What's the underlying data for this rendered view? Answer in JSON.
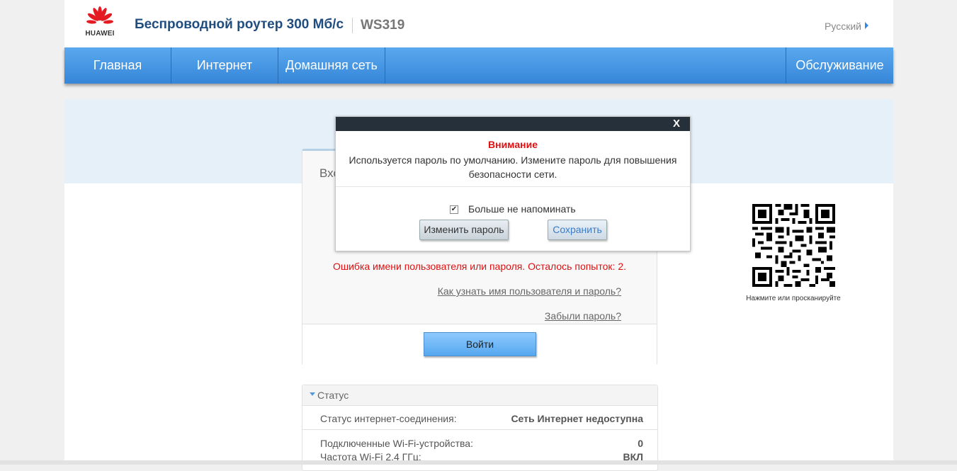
{
  "header": {
    "brand": "HUAWEI",
    "product_title": "Беспроводной роутер 300 Мб/с",
    "model": "WS319",
    "language": "Русский"
  },
  "nav": {
    "items": [
      "Главная",
      "Интернет",
      "Домашняя сеть"
    ],
    "right_item": "Обслуживание"
  },
  "login": {
    "title": "Вхо",
    "error": "Ошибка имени пользователя или пароля. Осталось попыток: 2.",
    "help_link": "Как узнать имя пользователя и пароль?",
    "forgot_link": "Забыли пароль?",
    "login_button": "Войти"
  },
  "status": {
    "title": "Статус",
    "rows": [
      {
        "label": "Статус интернет-соединения:",
        "value": "Сеть Интернет недоступна"
      },
      {
        "label": "Подключенные Wi-Fi-устройства:",
        "value": "0"
      },
      {
        "label": "Частота Wi-Fi 2,4 ГГц:",
        "value": "ВКЛ"
      }
    ]
  },
  "qr": {
    "caption": "Нажмите или просканируйте"
  },
  "dialog": {
    "close": "X",
    "title": "Внимание",
    "message": "Используется пароль по умолчанию. Измените пароль для повышения безопасности сети.",
    "checkbox_checked": true,
    "checkbox_mark": "✔",
    "checkbox_label": "Больше не напоминать",
    "change_button": "Изменить пароль",
    "save_button": "Сохранить"
  },
  "colors": {
    "brand_red": "#e41b23",
    "nav_blue": "#3586d9",
    "error_red": "#dd1111"
  }
}
